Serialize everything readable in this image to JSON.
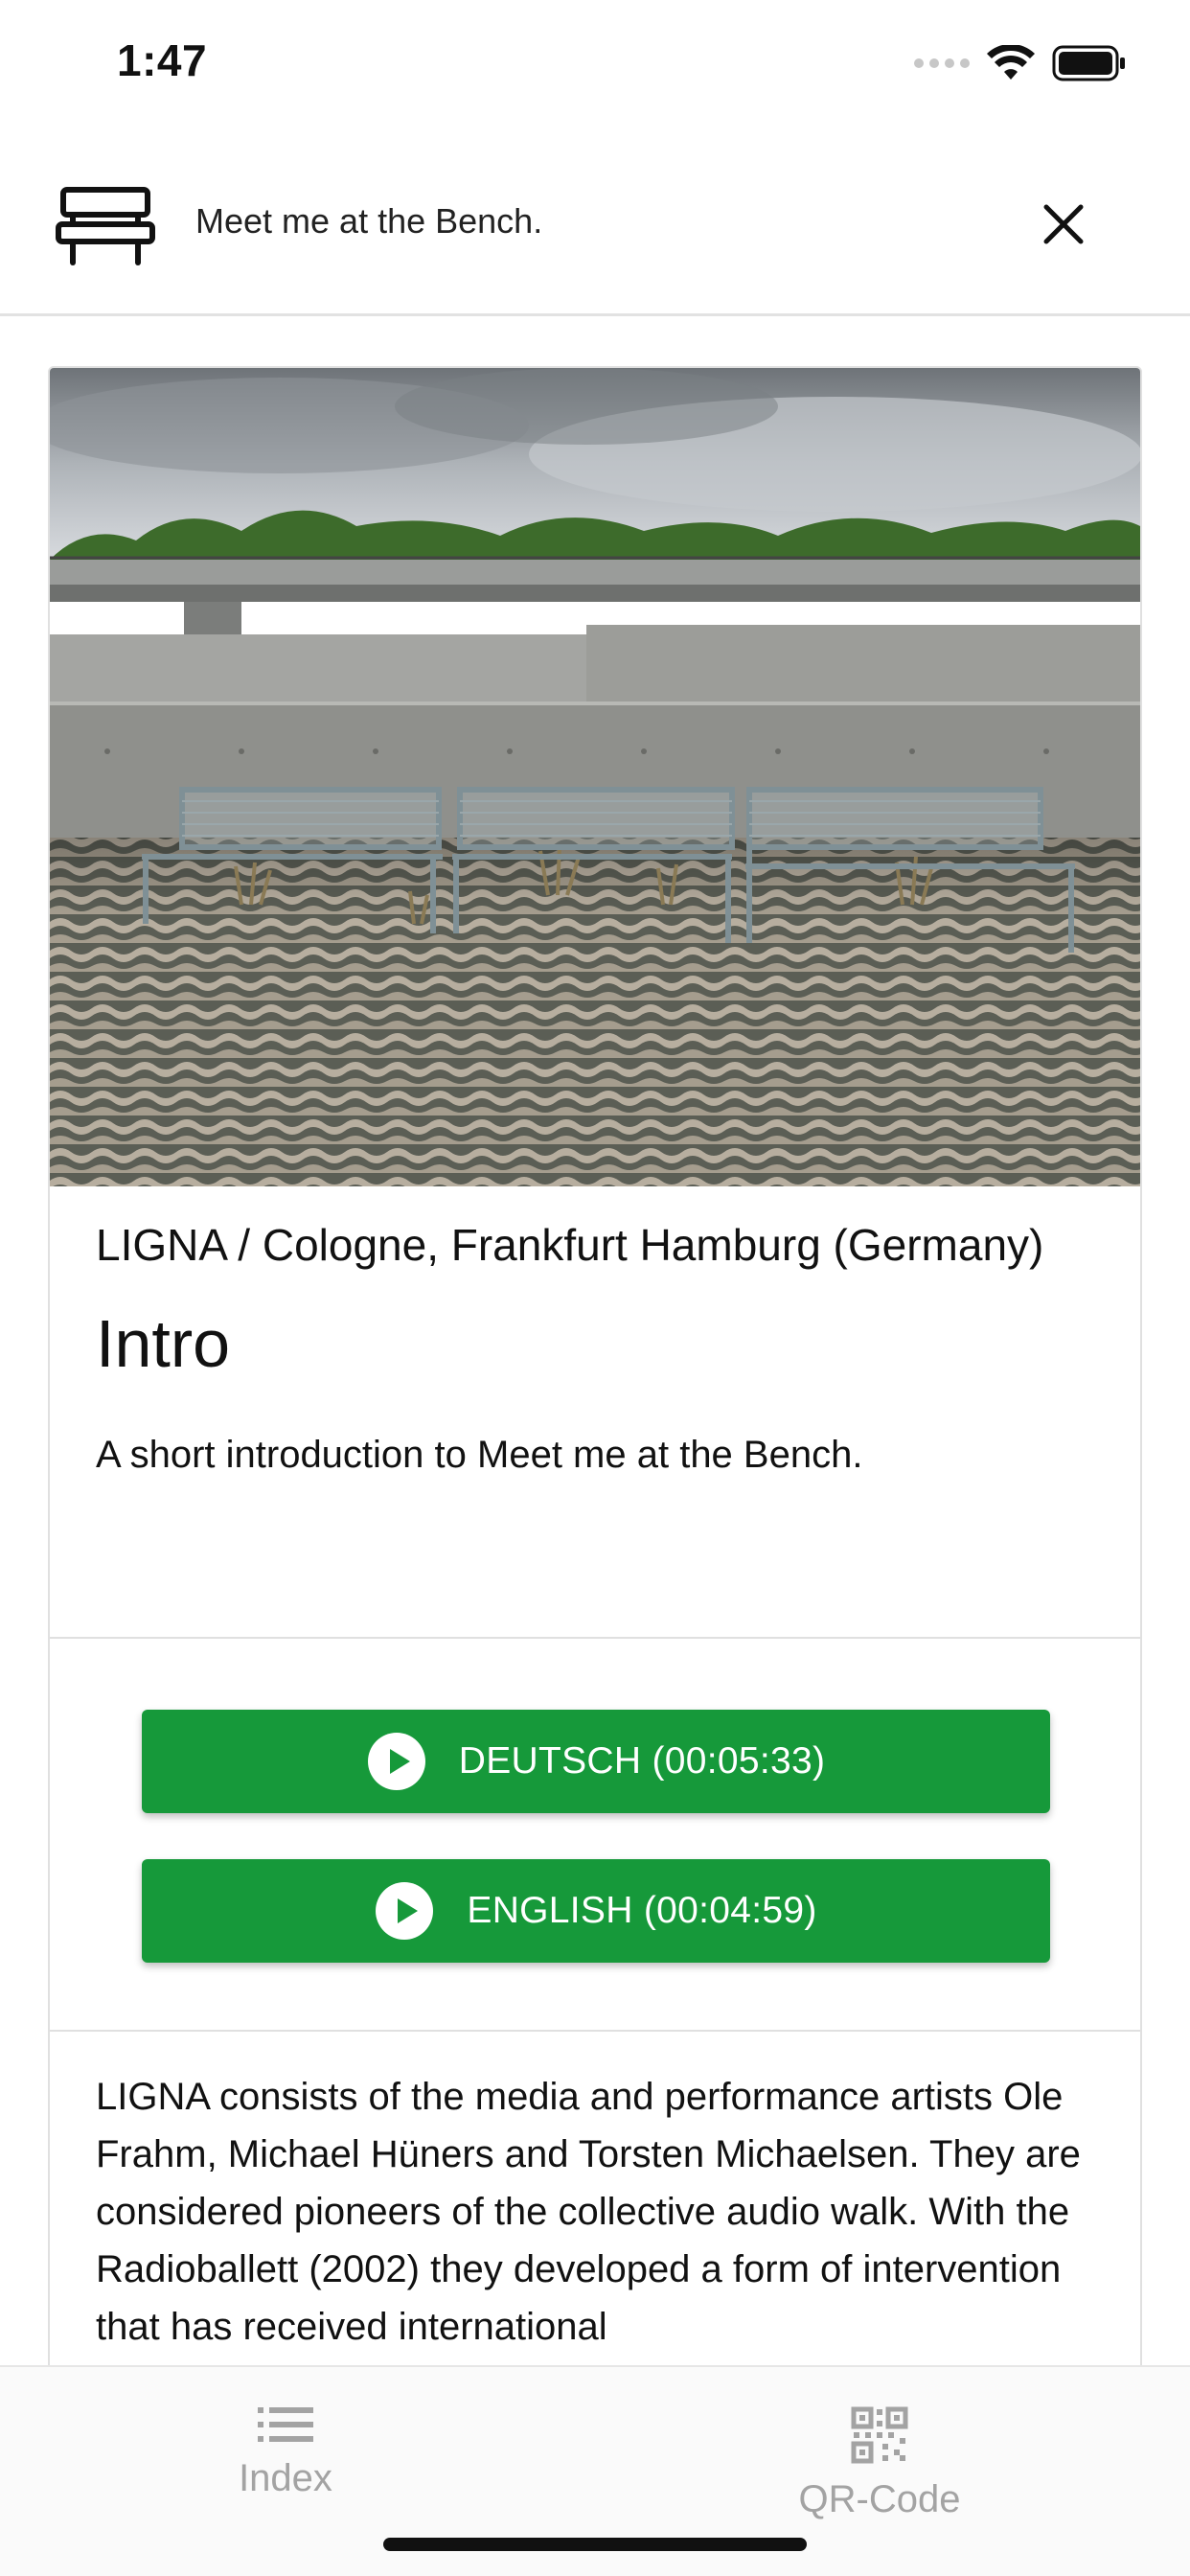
{
  "status_bar": {
    "time": "1:47"
  },
  "header": {
    "title": "Meet me at the Bench."
  },
  "station": {
    "artist": "LIGNA / Cologne, Frankfurt Hamburg (Germany)",
    "title": "Intro",
    "description": "A short introduction to Meet me at the Bench.",
    "audio_buttons": [
      {
        "label": "DEUTSCH (00:05:33)"
      },
      {
        "label": "ENGLISH (00:04:59)"
      }
    ],
    "body": "LIGNA consists of the media and performance artists Ole Frahm, Michael Hüners and Torsten Michaelsen. They are considered pioneers of the collective audio walk. With the Radioballett (2002) they developed a form of intervention that has received international"
  },
  "tabs": [
    {
      "label": "Index",
      "icon": "list-icon"
    },
    {
      "label": "QR-Code",
      "icon": "qr-code-icon"
    }
  ],
  "colors": {
    "accent": "#16993a",
    "tab_inactive": "#a3a3a3",
    "divider": "#e0e0e0"
  }
}
